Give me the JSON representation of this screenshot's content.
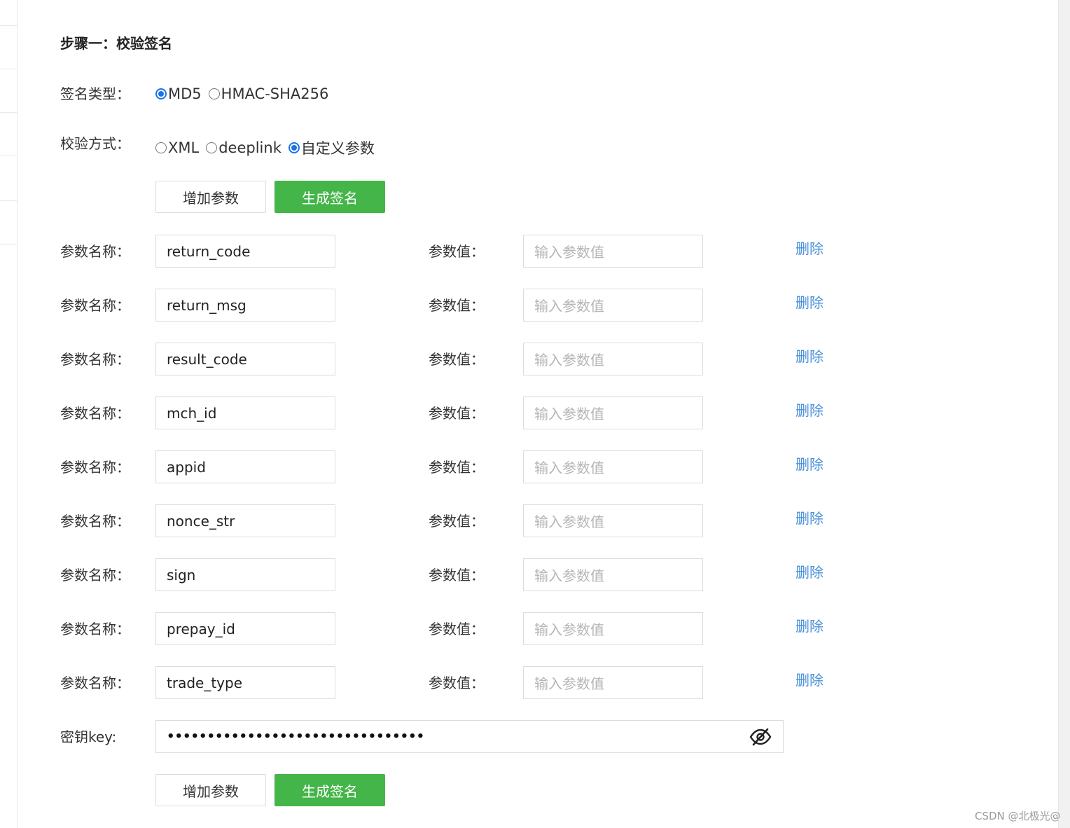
{
  "step": {
    "title": "步骤一：校验签名"
  },
  "sign_type": {
    "label": "签名类型：",
    "options": [
      {
        "label": "MD5",
        "checked": true
      },
      {
        "label": "HMAC-SHA256",
        "checked": false
      }
    ]
  },
  "verify_method": {
    "label": "校验方式：",
    "options": [
      {
        "label": "XML",
        "checked": false
      },
      {
        "label": "deeplink",
        "checked": false
      },
      {
        "label": "自定义参数",
        "checked": true
      }
    ]
  },
  "buttons": {
    "add_param": "增加参数",
    "generate_sign": "生成签名"
  },
  "params": {
    "name_label": "参数名称：",
    "value_label": "参数值：",
    "value_placeholder": "输入参数值",
    "delete_label": "删除",
    "rows": [
      {
        "name": "return_code"
      },
      {
        "name": "return_msg"
      },
      {
        "name": "result_code"
      },
      {
        "name": "mch_id"
      },
      {
        "name": "appid"
      },
      {
        "name": "nonce_str"
      },
      {
        "name": "sign"
      },
      {
        "name": "prepay_id"
      },
      {
        "name": "trade_type"
      }
    ]
  },
  "secret_key": {
    "label": "密钥key:",
    "masked_value": "••••••••••••••••••••••••••••••••",
    "icon": "eye-slash-icon"
  },
  "watermark": "CSDN @北极光@",
  "colors": {
    "primary": "#44b549",
    "link": "#4a90d9",
    "radio": "#1a73e8"
  }
}
